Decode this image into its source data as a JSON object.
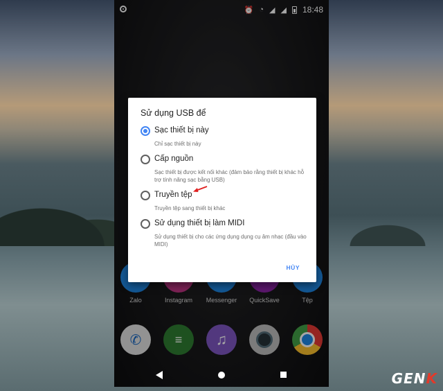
{
  "status_bar": {
    "time": "18:48"
  },
  "dialog": {
    "title": "Sử dụng USB để",
    "options": [
      {
        "label": "Sạc thiết bị này",
        "description": "Chỉ sạc thiết bị này",
        "selected": true
      },
      {
        "label": "Cấp nguồn",
        "description": "Sạc thiết bị được kết nối khác (đảm bảo rằng thiết bị khác hỗ trợ tính năng sạc bằng USB)",
        "selected": false
      },
      {
        "label": "Truyền tệp",
        "description": "Truyền tệp sang thiết bị khác",
        "selected": false
      },
      {
        "label": "Sử dụng thiết bị làm MIDI",
        "description": "Sử dụng thiết bị cho các ứng dụng dụng cụ âm nhạc (đầu vào MIDI)",
        "selected": false
      }
    ],
    "cancel_label": "HỦY"
  },
  "apps_row": [
    {
      "label": "Zalo",
      "icon": "zalo-icon",
      "color": "#1e88e5"
    },
    {
      "label": "Instagram",
      "icon": "instagram-icon",
      "color": "#c13584"
    },
    {
      "label": "Messenger",
      "icon": "messenger-icon",
      "color": "#1e88e5"
    },
    {
      "label": "QuickSave",
      "icon": "quicksave-icon",
      "color": "#8e24aa"
    },
    {
      "label": "Tệp",
      "icon": "files-icon",
      "color": "#1e88e5"
    }
  ],
  "dock": [
    {
      "icon": "phone-icon",
      "color": "#e0e0e0"
    },
    {
      "icon": "feedly-icon",
      "color": "#2e7d32"
    },
    {
      "icon": "music-icon",
      "color": "#7e57c2"
    },
    {
      "icon": "camera-icon",
      "color": "#bdbdbd"
    },
    {
      "icon": "chrome-icon",
      "color": "#e53935"
    }
  ],
  "watermark": {
    "main": "GEN",
    "accent": "K"
  },
  "colors": {
    "accent": "#4285f4",
    "arrow": "#e02020"
  }
}
